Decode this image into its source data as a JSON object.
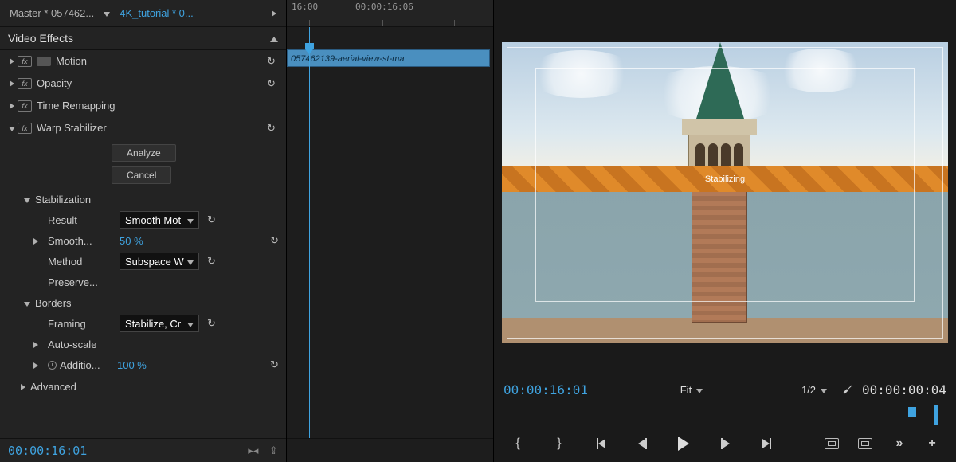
{
  "tabs": {
    "master": "Master * 057462...",
    "sequence": "4K_tutorial * 0..."
  },
  "section_title": "Video Effects",
  "effects": {
    "motion": "Motion",
    "opacity": "Opacity",
    "time_remapping": "Time Remapping",
    "warp": "Warp Stabilizer"
  },
  "warp": {
    "analyze_btn": "Analyze",
    "cancel_btn": "Cancel",
    "stabilization_head": "Stabilization",
    "result_label": "Result",
    "result_value": "Smooth Mot",
    "smooth_label": "Smooth...",
    "smooth_value": "50 %",
    "method_label": "Method",
    "method_value": "Subspace W",
    "preserve_label": "Preserve...",
    "borders_head": "Borders",
    "framing_label": "Framing",
    "framing_value": "Stabilize, Cr",
    "autoscale_label": "Auto-scale",
    "additional_label": "Additio...",
    "additional_value": "100 %",
    "advanced_head": "Advanced"
  },
  "footer_tc": "00:00:16:01",
  "timeline": {
    "tc1": "16:00",
    "tc2": "00:00:16:06",
    "clip_name": "057462139-aerial-view-st-ma"
  },
  "monitor": {
    "banner_text": "Stabilizing",
    "current_tc": "00:00:16:01",
    "zoom": "Fit",
    "resolution": "1/2",
    "duration_tc": "00:00:00:04"
  }
}
